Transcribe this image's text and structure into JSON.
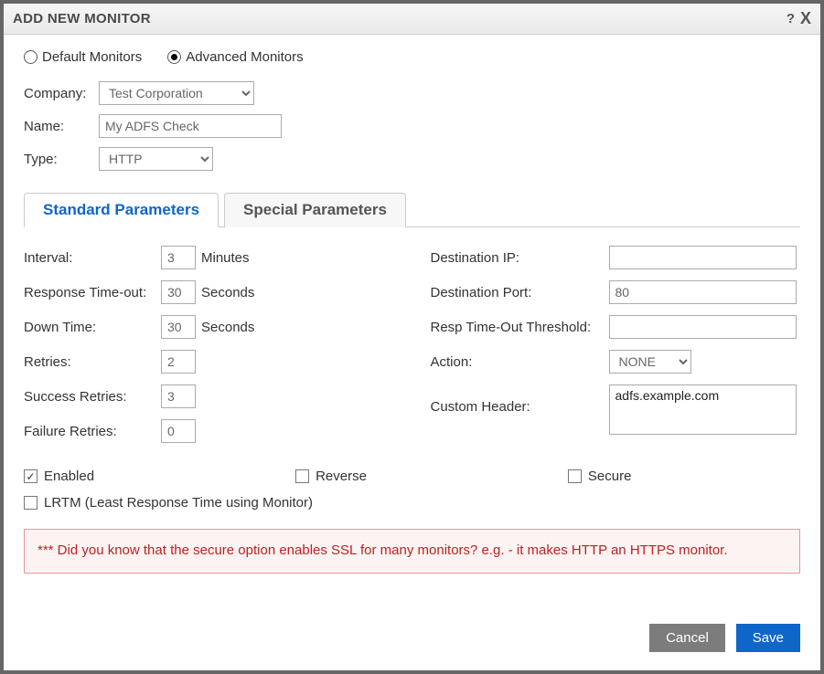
{
  "dialog": {
    "title": "ADD NEW MONITOR"
  },
  "monitor_type": {
    "default_label": "Default Monitors",
    "advanced_label": "Advanced Monitors",
    "selected": "advanced"
  },
  "fields": {
    "company_label": "Company:",
    "company_value": "Test Corporation",
    "name_label": "Name:",
    "name_value": "My ADFS Check",
    "type_label": "Type:",
    "type_value": "HTTP"
  },
  "tabs": {
    "standard": "Standard Parameters",
    "special": "Special Parameters",
    "active": "standard"
  },
  "std": {
    "interval_label": "Interval:",
    "interval_value": "3",
    "interval_unit": "Minutes",
    "resp_timeout_label": "Response Time-out:",
    "resp_timeout_value": "30",
    "resp_timeout_unit": "Seconds",
    "down_time_label": "Down Time:",
    "down_time_value": "30",
    "down_time_unit": "Seconds",
    "retries_label": "Retries:",
    "retries_value": "2",
    "success_retries_label": "Success Retries:",
    "success_retries_value": "3",
    "failure_retries_label": "Failure Retries:",
    "failure_retries_value": "0",
    "dest_ip_label": "Destination IP:",
    "dest_ip_value": "",
    "dest_port_label": "Destination Port:",
    "dest_port_value": "80",
    "resp_threshold_label": "Resp Time-Out Threshold:",
    "resp_threshold_value": "",
    "action_label": "Action:",
    "action_value": "NONE",
    "custom_header_label": "Custom Header:",
    "custom_header_value": "adfs.example.com"
  },
  "checks": {
    "enabled_label": "Enabled",
    "enabled_checked": true,
    "reverse_label": "Reverse",
    "reverse_checked": false,
    "secure_label": "Secure",
    "secure_checked": false,
    "lrtm_label": "LRTM (Least Response Time using Monitor)",
    "lrtm_checked": false
  },
  "info": "*** Did you know that the secure option enables SSL for many monitors? e.g. - it makes HTTP an HTTPS monitor.",
  "buttons": {
    "cancel": "Cancel",
    "save": "Save"
  }
}
